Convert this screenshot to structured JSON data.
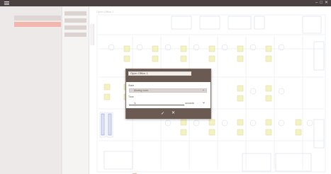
{
  "window": {
    "controls": [
      "–",
      "□",
      "✕"
    ]
  },
  "sidebar": {
    "items": [
      {
        "label": "",
        "count": "",
        "state": "inactive"
      },
      {
        "label": "",
        "count": "",
        "state": "active"
      }
    ]
  },
  "subpanel": {
    "items": [
      "",
      "",
      "",
      ""
    ]
  },
  "main": {
    "floor_title": "Open Office 1",
    "side_note": ""
  },
  "dialog": {
    "title_value": "Open Office 1",
    "state_label": "State",
    "state_value": "Moving room",
    "time_label": "Time",
    "time_value": "1",
    "time_unit": "seconds",
    "ok_icon": "✓",
    "cancel_icon": "✕"
  },
  "colors": {
    "titlebar": "#4a4140",
    "accent": "#f0a79a",
    "dialog_header": "#6a5a52",
    "desk_yellow": "#f3efb2"
  },
  "icons": [
    "menu-icon",
    "minimize-icon",
    "maximize-icon",
    "close-icon",
    "chevron-down-icon",
    "check-icon",
    "close-icon"
  ]
}
